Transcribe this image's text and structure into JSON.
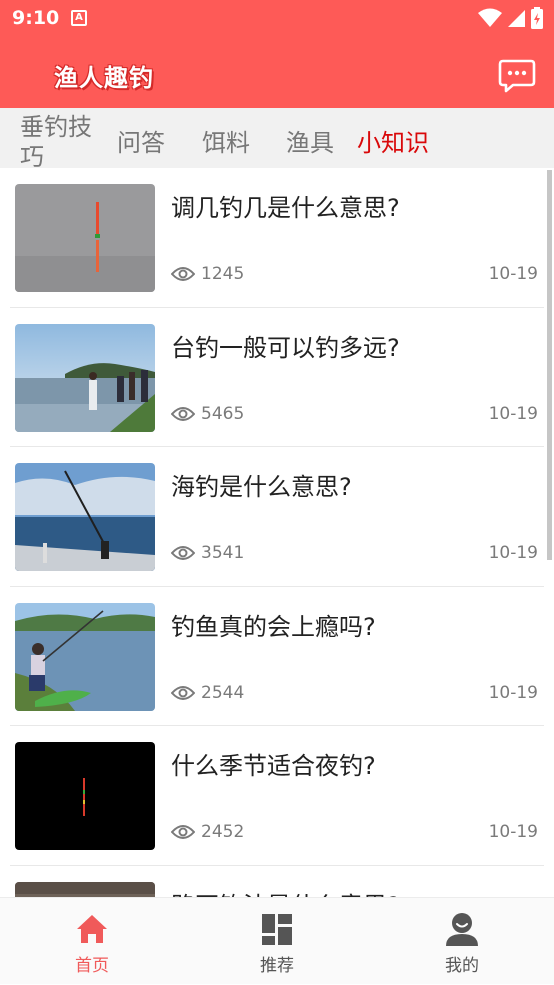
{
  "status_bar": {
    "time": "9:10",
    "a_icon": "A"
  },
  "header": {
    "logo_text": "渔人趣钓",
    "chat_icon": "chat-bubble-icon"
  },
  "tabs": [
    {
      "label": "垂钓技巧",
      "active": false
    },
    {
      "label": "问答",
      "active": false
    },
    {
      "label": "饵料",
      "active": false
    },
    {
      "label": "渔具",
      "active": false
    },
    {
      "label": "小知识",
      "active": true
    }
  ],
  "articles": [
    {
      "title": "调几钓几是什么意思?",
      "views": "1245",
      "date": "10-19",
      "thumb": "float-on-water"
    },
    {
      "title": "台钓一般可以钓多远?",
      "views": "5465",
      "date": "10-19",
      "thumb": "lake-anglers"
    },
    {
      "title": "海钓是什么意思?",
      "views": "3541",
      "date": "10-19",
      "thumb": "boat-rod"
    },
    {
      "title": "钓鱼真的会上瘾吗?",
      "views": "2544",
      "date": "10-19",
      "thumb": "shore-fisher"
    },
    {
      "title": "什么季节适合夜钓?",
      "views": "2452",
      "date": "10-19",
      "thumb": "night-float"
    },
    {
      "title": "路亚钓法是什么意思?",
      "views": "",
      "date": "",
      "thumb": "rocky"
    }
  ],
  "bottom_nav": [
    {
      "label": "首页",
      "icon": "home-icon",
      "active": true
    },
    {
      "label": "推荐",
      "icon": "grid-icon",
      "active": false
    },
    {
      "label": "我的",
      "icon": "profile-icon",
      "active": false
    }
  ],
  "colors": {
    "brand": "#fe5a57",
    "active_tab": "#d9080a",
    "nav_active": "#f05a5a"
  }
}
